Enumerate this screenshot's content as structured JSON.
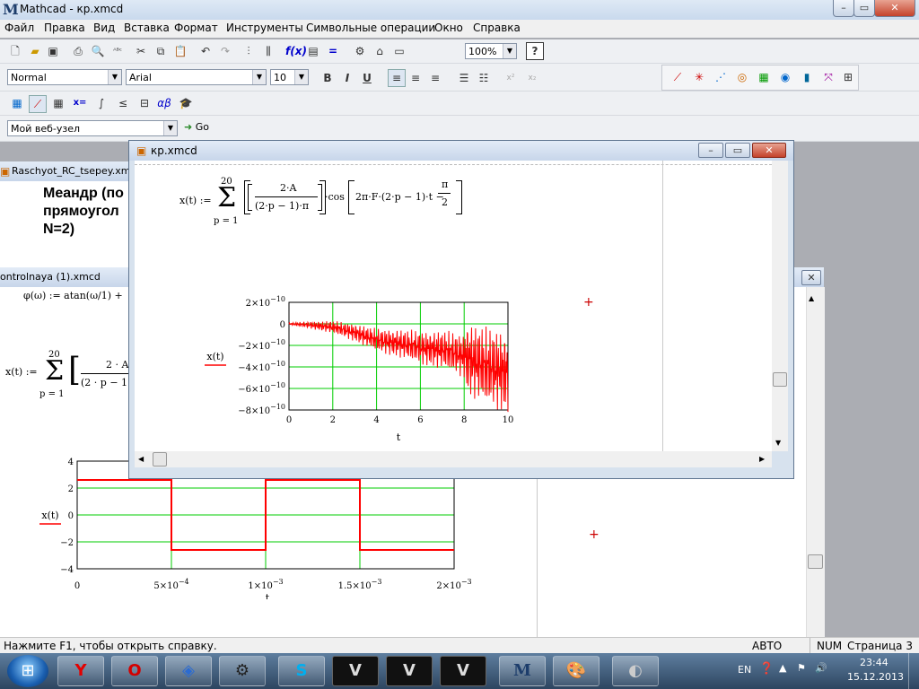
{
  "app": {
    "title": "Mathcad - кр.xmcd",
    "logo": "M"
  },
  "menu": [
    "Файл",
    "Правка",
    "Вид",
    "Вставка",
    "Формат",
    "Инструменты",
    "Символьные операции",
    "Окно",
    "Справка"
  ],
  "toolbar": {
    "zoom": "100%",
    "style": "Normal",
    "font": "Arial",
    "size": "10",
    "bold": "B",
    "italic": "I",
    "underline": "U",
    "web_node": "Мой веб-узел",
    "go": "Go"
  },
  "doc_back": {
    "title": "Raschyot_RC_tsepey.xmcd",
    "heading_lines": [
      "Меандр (по",
      "прямоугол",
      "N=2)"
    ]
  },
  "doc_mid": {
    "title": "ontrolnaya (1).xmcd",
    "phi_line": "φ(ω) := atan(ω/1) +",
    "sum_upper": "20",
    "sum_lower": "p = 1",
    "lhs": "x(t) :=",
    "frac_num": "2 · A",
    "frac_den": "(2 · p − 1"
  },
  "doc_front": {
    "title": "кр.xmcd",
    "lhs": "x(t) :=",
    "sum_upper": "20",
    "sum_lower": "p = 1",
    "frac_num": "2·A",
    "frac_den": "(2·p − 1)·π",
    "cos": "·cos",
    "arg": "2π·F·(2·p − 1)·t −",
    "pi_num": "π",
    "pi_den": "2"
  },
  "chart_data": [
    {
      "type": "line",
      "ylabel": "x(t)",
      "xlabel": "t",
      "xlim": [
        0,
        10
      ],
      "ylim": [
        -8e-10,
        2e-10
      ],
      "xticks": [
        "0",
        "2",
        "4",
        "6",
        "8",
        "10"
      ],
      "yticks": [
        {
          "m": "2×10",
          "e": "−10"
        },
        {
          "m": "0",
          "e": ""
        },
        {
          "m": "−2×10",
          "e": "−10"
        },
        {
          "m": "−4×10",
          "e": "−10"
        },
        {
          "m": "−6×10",
          "e": "−10"
        },
        {
          "m": "−8×10",
          "e": "−10"
        }
      ],
      "grid": true,
      "series": [
        {
          "color": "#ff0000",
          "x": [
            0,
            1,
            2,
            3,
            4,
            5,
            6,
            7,
            8,
            9,
            10
          ],
          "y": [
            0,
            -1e-11,
            -3e-11,
            -8e-11,
            -1.5e-10,
            -1.8e-10,
            -2.2e-10,
            -2.4e-10,
            -3e-10,
            -4e-10,
            -4.5e-10
          ]
        }
      ]
    },
    {
      "type": "line",
      "ylabel": "x(t)",
      "xlabel": "t",
      "xlim": [
        0,
        0.002
      ],
      "ylim": [
        -4,
        4
      ],
      "xticks": [
        {
          "m": "0",
          "e": ""
        },
        {
          "m": "5×10",
          "e": "−4"
        },
        {
          "m": "1×10",
          "e": "−3"
        },
        {
          "m": "1.5×10",
          "e": "−3"
        },
        {
          "m": "2×10",
          "e": "−3"
        }
      ],
      "yticks": [
        "4",
        "2",
        "0",
        "−2",
        "−4"
      ],
      "grid": true,
      "series": [
        {
          "color": "#ff0000",
          "x": [
            0,
            0.0005,
            0.0005,
            0.001,
            0.001,
            0.0015,
            0.0015,
            0.002
          ],
          "y": [
            2.6,
            2.6,
            -2.6,
            -2.6,
            2.6,
            2.6,
            -2.6,
            -2.6
          ]
        }
      ]
    }
  ],
  "status": {
    "help": "Нажмите F1, чтобы открыть справку.",
    "mode": "АВТО",
    "num": "NUM",
    "page": "Страница 3"
  },
  "taskbar": {
    "lang": "EN",
    "time": "23:44",
    "date": "15.12.2013",
    "apps": [
      "yandex-browser",
      "opera",
      "total-commander",
      "steam",
      "skype",
      "stalker-1",
      "stalker-2",
      "stalker-3",
      "mathcad",
      "paint",
      "mouse-app"
    ]
  }
}
